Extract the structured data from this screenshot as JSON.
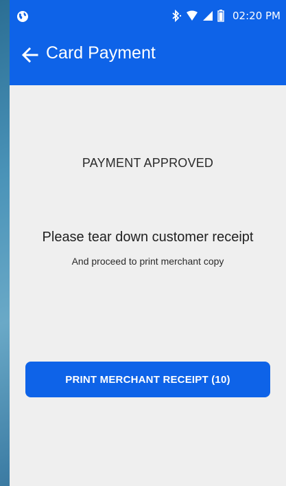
{
  "status_bar": {
    "time": "02:20 PM",
    "icons": [
      "globe-icon",
      "bluetooth-icon",
      "wifi-icon",
      "signal-icon",
      "battery-icon"
    ]
  },
  "app_bar": {
    "title": "Card Payment",
    "back_icon": "arrow-left-icon"
  },
  "content": {
    "status_title": "PAYMENT APPROVED",
    "message_main": "Please tear down customer receipt",
    "message_sub": "And proceed to print merchant copy"
  },
  "actions": {
    "print_button_label": "PRINT MERCHANT RECEIPT (10)"
  },
  "colors": {
    "accent": "#0e63e8",
    "background": "#efefef"
  }
}
